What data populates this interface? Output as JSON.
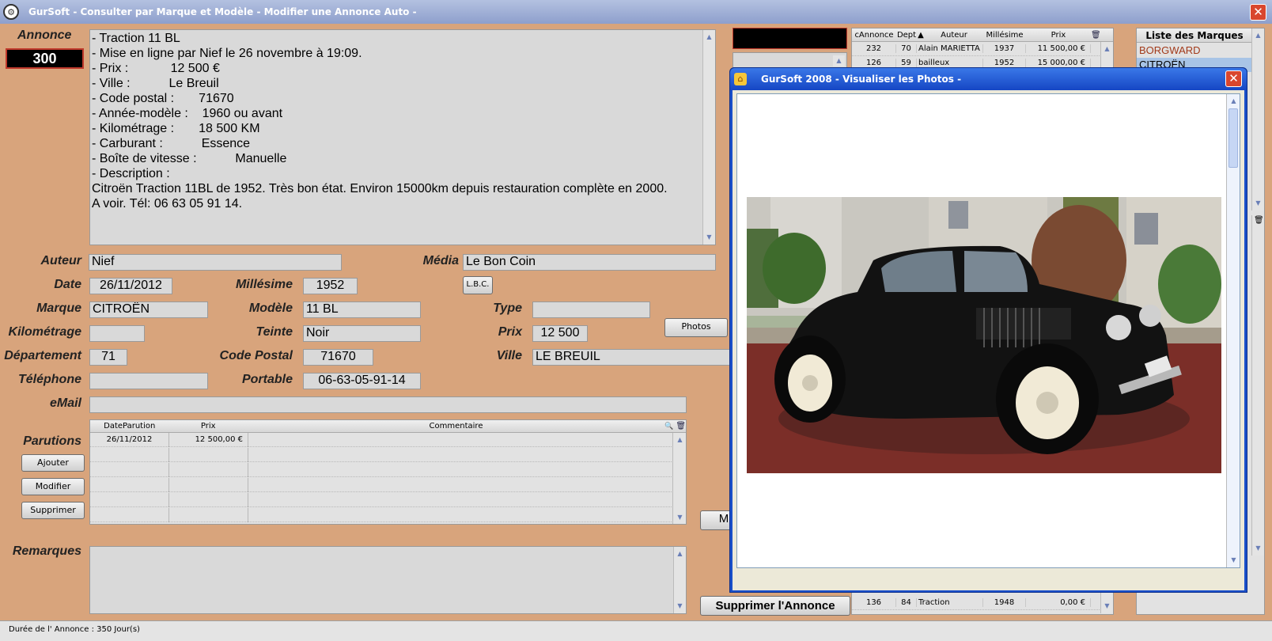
{
  "window": {
    "title": "GurSoft  -  Consulter par Marque et Modèle - Modifier une Annonce Auto  -"
  },
  "annonce": {
    "label": "Annonce",
    "number": "300",
    "text_lines": [
      "- Traction 11 BL",
      "- Mise en ligne par Nief le 26 novembre à 19:09.",
      "- Prix :            12 500 €",
      "- Ville :           Le Breuil",
      "- Code postal :       71670",
      "- Année-modèle :    1960 ou avant",
      "- Kilométrage :       18 500 KM",
      "- Carburant :           Essence",
      "- Boîte de vitesse :           Manuelle",
      "- Description :",
      "Citroën Traction 11BL de 1952. Très bon état. Environ 15000km depuis restauration complète en 2000.",
      "A voir. Tél: 06 63 05 91 14."
    ]
  },
  "fields": {
    "auteur": {
      "label": "Auteur",
      "value": "Nief"
    },
    "media": {
      "label": "Média",
      "value": "Le Bon Coin"
    },
    "date": {
      "label": "Date",
      "value": "26/11/2012"
    },
    "millesime": {
      "label": "Millésime",
      "value": "1952"
    },
    "lbc_button": "L.B.C.",
    "marque": {
      "label": "Marque",
      "value": "CITROËN"
    },
    "modele": {
      "label": "Modèle",
      "value": "11 BL"
    },
    "type": {
      "label": "Type",
      "value": ""
    },
    "kilometrage": {
      "label": "Kilométrage",
      "value": ""
    },
    "teinte": {
      "label": "Teinte",
      "value": "Noir"
    },
    "prix": {
      "label": "Prix",
      "value": "12 500"
    },
    "photos_button": "Photos",
    "departement": {
      "label": "Département",
      "value": "71"
    },
    "code_postal": {
      "label": "Code Postal",
      "value": "71670"
    },
    "ville": {
      "label": "Ville",
      "value": "LE BREUIL"
    },
    "telephone": {
      "label": "Téléphone",
      "value": ""
    },
    "portable": {
      "label": "Portable",
      "value": "06-63-05-91-14"
    },
    "email": {
      "label": "eMail",
      "value": ""
    }
  },
  "parutions": {
    "label": "Parutions",
    "columns": [
      "DateParution",
      "Prix",
      "Commentaire"
    ],
    "rows": [
      {
        "date": "26/11/2012",
        "prix": "12 500,00 €",
        "commentaire": ""
      }
    ],
    "buttons": {
      "ajouter": "Ajouter",
      "modifier": "Modifier",
      "supprimer": "Supprimer"
    }
  },
  "remarques": {
    "label": "Remarques",
    "value": ""
  },
  "status": {
    "text": "Durée de l' Annonce : 350 Jour(s)"
  },
  "annonces_table": {
    "columns": [
      "cAnnonce",
      "Dept",
      "Auteur",
      "Millésime",
      "Prix"
    ],
    "rows": [
      {
        "c": "232",
        "dept": "70",
        "auteur": "Alain MARIETTA",
        "mill": "1937",
        "prix": "11 500,00 €"
      },
      {
        "c": "126",
        "dept": "59",
        "auteur": "bailleux",
        "mill": "1952",
        "prix": "15 000,00 €"
      },
      {
        "c": "136",
        "dept": "84",
        "auteur": "Traction",
        "mill": "1948",
        "prix": "0,00 €"
      }
    ]
  },
  "marques": {
    "header": "Liste des Marques",
    "items": [
      "BORGWARD",
      "CITROËN"
    ]
  },
  "delete_button": "Supprimer l'Annonce",
  "partial_button": "M",
  "photo_window": {
    "title": "GurSoft 2008 -   Visualiser les Photos   -"
  },
  "colors": {
    "background": "#d8a47c",
    "titlebar": "#98a8d4",
    "field": "#d9d9d9",
    "close": "#d9462e",
    "dialog_border": "#1a4fc9"
  }
}
